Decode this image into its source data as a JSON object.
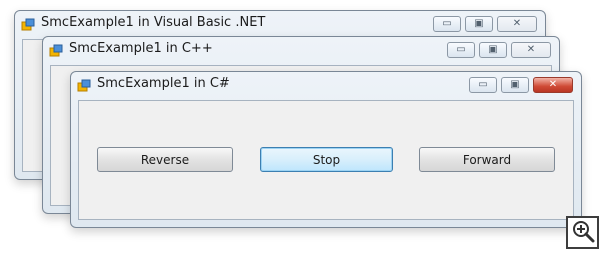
{
  "windows": {
    "vbnet": {
      "title": "SmcExample1 in Visual Basic .NET"
    },
    "cpp": {
      "title": "SmcExample1 in C++"
    },
    "csharp": {
      "title": "SmcExample1 in C#",
      "buttons": {
        "reverse": "Reverse",
        "stop": "Stop",
        "forward": "Forward"
      }
    }
  },
  "icons": {
    "app": "app-icon",
    "minimize": "minimize-icon",
    "maximize": "maximize-icon",
    "close": "close-icon",
    "zoom": "zoom-in-icon"
  },
  "colors": {
    "close_active": "#cf4a35",
    "focus_border": "#3c7fb1"
  }
}
